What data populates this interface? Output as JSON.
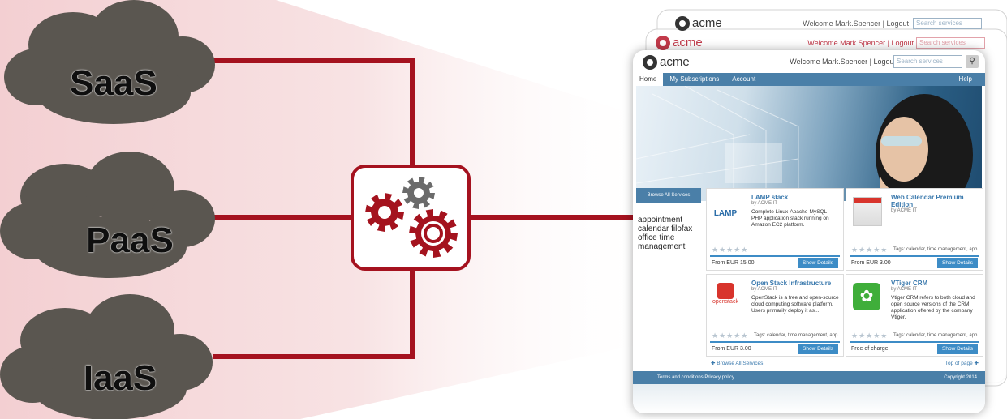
{
  "clouds": [
    {
      "label": "SaaS"
    },
    {
      "label": "PaaS"
    },
    {
      "label": "IaaS"
    }
  ],
  "colors": {
    "accent": "#a5121f",
    "cloud": "#5a5650",
    "gear_red": "#a4131e",
    "gear_gray": "#6b6b6b",
    "panel": "#f6dadc"
  },
  "icons": {
    "hub": "gears-icon"
  },
  "screenshot": {
    "logo": "acme",
    "welcome": "Welcome Mark.Spencer | Logout",
    "search_placeholder": "Search services",
    "nav": [
      "Home",
      "My Subscriptions",
      "Account"
    ],
    "nav_help": "Help",
    "browse_all": "Browse All Services",
    "tags": "appointment calendar filofax office time management",
    "tiles": [
      {
        "title": "LAMP stack",
        "by": "by ACME IT",
        "desc": "Complete Linux-Apache-MySQL-PHP application stack running on Amazon EC2 platform.",
        "tags": "",
        "price": "From EUR 15.00",
        "button": "Show Details",
        "icon_label": "LAMP"
      },
      {
        "title": "Web Calendar Premium Edition",
        "by": "by ACME IT",
        "desc": "",
        "tags": "Tags: calendar, time management, app...",
        "price": "From EUR 3.00",
        "button": "Show Details",
        "icon_label": ""
      },
      {
        "title": "Open Stack Infrastructure",
        "by": "by ACME IT",
        "desc": "OpenStack is a free and open-source cloud computing software platform. Users primarily deploy it as...",
        "tags": "Tags: calendar, time management, app...",
        "price": "From EUR 3.00",
        "button": "Show Details",
        "icon_label": "openstack"
      },
      {
        "title": "VTiger CRM",
        "by": "by ACME IT",
        "desc": "Vtiger CRM refers to both cloud and open source versions of the CRM application offered by the company Vtiger.",
        "tags": "Tags: calendar, time management, app...",
        "price": "Free of charge",
        "button": "Show Details",
        "icon_label": ""
      }
    ],
    "browse_link": "Browse All Services",
    "top_link": "Top of page",
    "footer_links": "Terms and conditions  Privacy policy",
    "copyright": "Copyright 2014"
  }
}
